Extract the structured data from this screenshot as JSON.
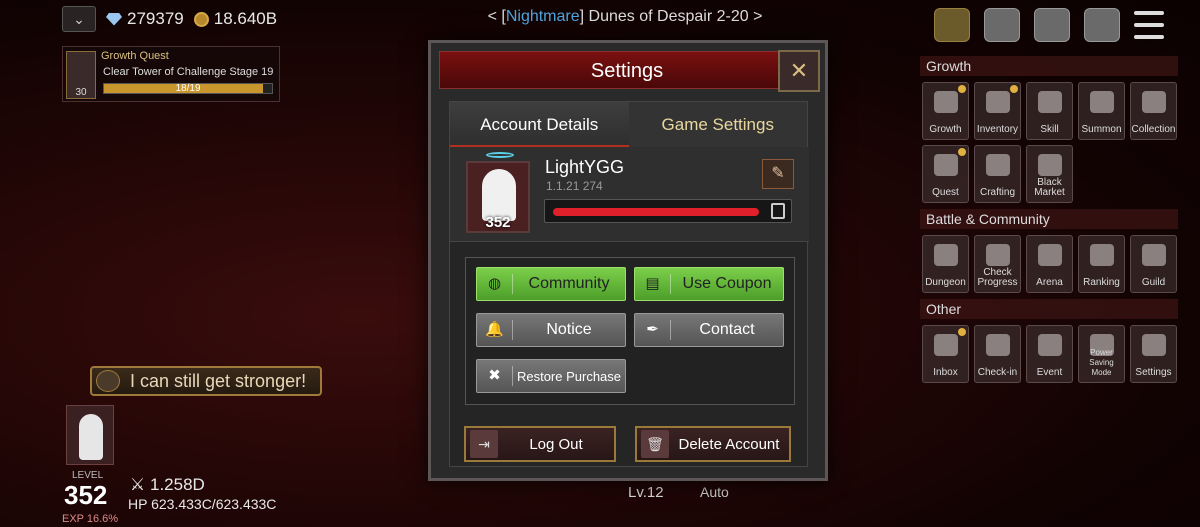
{
  "hud": {
    "diamonds": "279379",
    "gold": "18.640B",
    "stage_open": "< [",
    "stage_difficulty": "Nightmare",
    "stage_name": "] Dunes of Despair 2-20 >"
  },
  "quest": {
    "title": "Growth Quest",
    "description": "Clear Tower of Challenge Stage 19",
    "progress_text": "18/19",
    "progress": 0.947,
    "level": "30"
  },
  "bubble_text": "I can still get stronger!",
  "player": {
    "level_label": "LEVEL",
    "level": "352",
    "power": "1.258D",
    "hp_label": "HP",
    "hp_value": "623.433C/623.433C",
    "exp_text": "EXP 16.6%"
  },
  "bottom": {
    "level": "Lv.12",
    "auto": "Auto"
  },
  "menu": {
    "sections": [
      {
        "title": "Growth",
        "items": [
          "Growth",
          "Inventory",
          "Skill",
          "Summon",
          "Collection",
          "Quest",
          "Crafting",
          "Black Market"
        ]
      },
      {
        "title": "Battle & Community",
        "items": [
          "Dungeon",
          "Check Progress",
          "Arena",
          "Ranking",
          "Guild"
        ]
      },
      {
        "title": "Other",
        "items": [
          "Inbox",
          "Check-in",
          "Event",
          "Power Saving Mode",
          "Settings"
        ]
      }
    ]
  },
  "dialog": {
    "title": "Settings",
    "tabs": [
      "Account Details",
      "Game Settings"
    ],
    "username": "LightYGG",
    "version": "1.1.21 274",
    "avatar_level": "352",
    "buttons": {
      "community": "Community",
      "use_coupon": "Use Coupon",
      "notice": "Notice",
      "contact": "Contact",
      "restore_purchase": "Restore Purchase",
      "log_out": "Log Out",
      "delete_account": "Delete Account"
    }
  },
  "colors": {
    "accent_red": "#7a1010",
    "green_button": "#6cbf3e",
    "nightmare_blue": "#4fa5e0",
    "gold_border": "#9a7a3a"
  }
}
